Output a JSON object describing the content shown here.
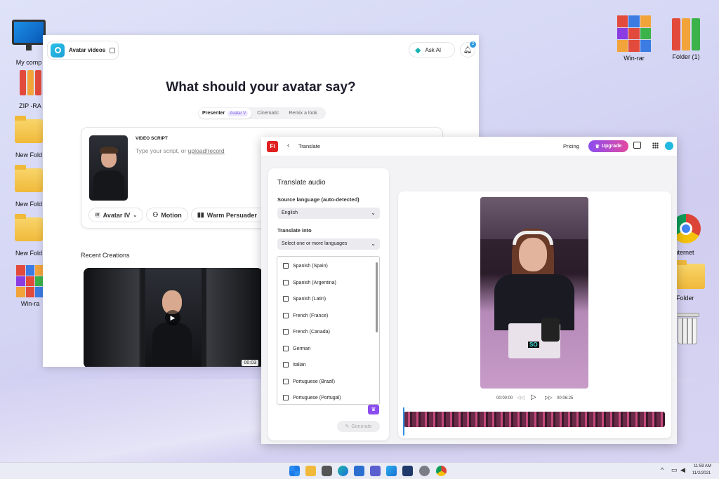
{
  "desktop": {
    "left": [
      "My comp",
      "ZIP -RA",
      "New Fold",
      "New Fold",
      "New Fold",
      "Win-ra"
    ],
    "right": [
      "Win-rar",
      "Folder (1)",
      "Internet",
      "w Folder"
    ]
  },
  "w1": {
    "app_title": "Avatar videos",
    "ask_ai": "Ask AI",
    "notif_count": "2",
    "heading": "What should your avatar say?",
    "tabs": [
      "Presenter",
      "Cinematic",
      "Remix a look"
    ],
    "tabs_badge": "Avatar V",
    "script_label": "VIDEO SCRIPT",
    "script_placeholder": "Type your script, or ",
    "script_link": "upload/record",
    "options": [
      "Avatar IV",
      "Motion",
      "Warm Persuader"
    ],
    "recent_title": "Recent Creations",
    "recent_duration": "00:03"
  },
  "w2": {
    "logo_text": "Fi",
    "page_title": "Translate",
    "pricing": "Pricing",
    "upgrade": "Upgrade",
    "panel": {
      "title": "Translate audio",
      "source_label": "Source language (auto-detected)",
      "source_value": "English",
      "target_label": "Translate into",
      "target_placeholder": "Select one or more languages",
      "languages": [
        "Spanish (Spain)",
        "Spanish (Argentina)",
        "Spanish (Latin)",
        "French (France)",
        "French (Canada)",
        "German",
        "Italian",
        "Portuguese (Brazil)",
        "Portuguese (Portugal)"
      ],
      "generate": "Generate"
    },
    "preview": {
      "caption": "SO",
      "time_current": "00:00:00",
      "time_total": "00:06:25"
    }
  },
  "taskbar": {
    "time": "11:59 AM",
    "date": "11/2/2021"
  },
  "colors": {
    "accent_blue": "#2f9be0",
    "upgrade_gradient_start": "#8a4cf0",
    "upgrade_gradient_end": "#e24aa0",
    "logo_red": "#e02020"
  }
}
